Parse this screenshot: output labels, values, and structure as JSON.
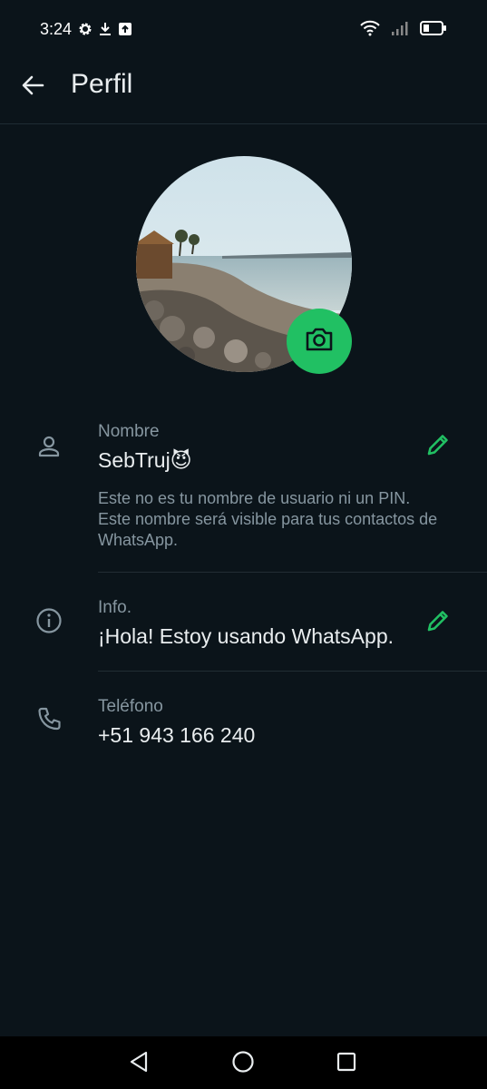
{
  "status_bar": {
    "time": "3:24",
    "left_icons": [
      "gear-icon",
      "download-icon",
      "upload-icon"
    ],
    "right_icons": [
      "wifi-icon",
      "signal-icon",
      "battery-icon"
    ]
  },
  "header": {
    "title": "Perfil",
    "back_icon": "arrow-left-icon"
  },
  "profile": {
    "photo": "beach-photo",
    "camera_icon": "camera-icon",
    "accent": "#21c063"
  },
  "name_row": {
    "label": "Nombre",
    "value": "SebTruj😈",
    "help": "Este no es tu nombre de usuario ni un PIN. Este nombre será visible para tus contactos de WhatsApp.",
    "icon": "person-icon",
    "edit_icon": "pencil-icon"
  },
  "info_row": {
    "label": "Info.",
    "value": "¡Hola! Estoy usando WhatsApp.",
    "icon": "info-icon",
    "edit_icon": "pencil-icon"
  },
  "phone_row": {
    "label": "Teléfono",
    "value": "+51 943 166 240",
    "icon": "phone-icon"
  },
  "nav_bar": {
    "buttons": [
      "back-triangle-icon",
      "home-circle-icon",
      "recents-square-icon"
    ]
  },
  "colors": {
    "background": "#0b141a",
    "text_primary": "#e9edef",
    "text_secondary": "#8696a0",
    "accent": "#21c063"
  }
}
